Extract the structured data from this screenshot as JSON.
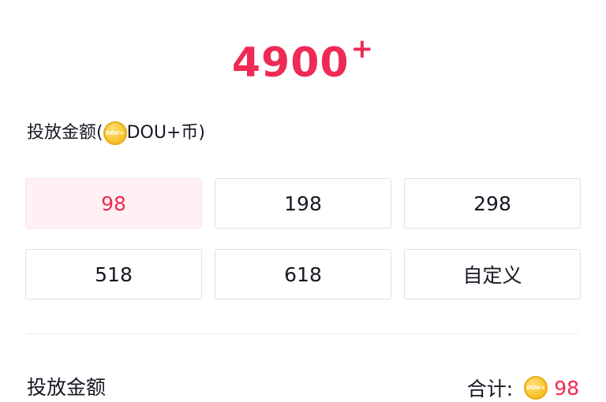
{
  "header": {
    "reach_number": "4900",
    "reach_suffix": "+"
  },
  "amount_section": {
    "label_prefix": "投放金额(",
    "label_suffix": "DOU+币)",
    "coin_icon": "dou-coin-icon"
  },
  "options": [
    {
      "label": "98",
      "selected": true
    },
    {
      "label": "198",
      "selected": false
    },
    {
      "label": "298",
      "selected": false
    },
    {
      "label": "518",
      "selected": false
    },
    {
      "label": "618",
      "selected": false
    },
    {
      "label": "自定义",
      "selected": false
    }
  ],
  "footer": {
    "label": "投放金额",
    "total_label": "合计:",
    "total_value": "98"
  },
  "colors": {
    "accent": "#ee2a55",
    "selected_bg": "#fff0f3",
    "text": "#161823",
    "border": "#e1e1e5"
  }
}
